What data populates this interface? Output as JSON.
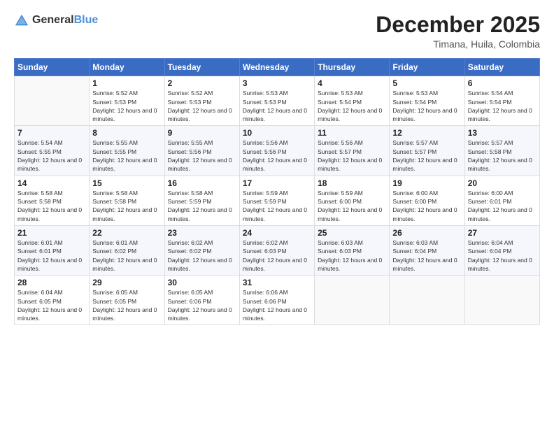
{
  "header": {
    "logo_general": "General",
    "logo_blue": "Blue",
    "title": "December 2025",
    "location": "Timana, Huila, Colombia"
  },
  "weekdays": [
    "Sunday",
    "Monday",
    "Tuesday",
    "Wednesday",
    "Thursday",
    "Friday",
    "Saturday"
  ],
  "weeks": [
    [
      {
        "day": "",
        "sunrise": "",
        "sunset": "",
        "daylight": ""
      },
      {
        "day": "1",
        "sunrise": "5:52 AM",
        "sunset": "5:53 PM",
        "daylight": "12 hours and 0 minutes."
      },
      {
        "day": "2",
        "sunrise": "5:52 AM",
        "sunset": "5:53 PM",
        "daylight": "12 hours and 0 minutes."
      },
      {
        "day": "3",
        "sunrise": "5:53 AM",
        "sunset": "5:53 PM",
        "daylight": "12 hours and 0 minutes."
      },
      {
        "day": "4",
        "sunrise": "5:53 AM",
        "sunset": "5:54 PM",
        "daylight": "12 hours and 0 minutes."
      },
      {
        "day": "5",
        "sunrise": "5:53 AM",
        "sunset": "5:54 PM",
        "daylight": "12 hours and 0 minutes."
      },
      {
        "day": "6",
        "sunrise": "5:54 AM",
        "sunset": "5:54 PM",
        "daylight": "12 hours and 0 minutes."
      }
    ],
    [
      {
        "day": "7",
        "sunrise": "5:54 AM",
        "sunset": "5:55 PM",
        "daylight": "12 hours and 0 minutes."
      },
      {
        "day": "8",
        "sunrise": "5:55 AM",
        "sunset": "5:55 PM",
        "daylight": "12 hours and 0 minutes."
      },
      {
        "day": "9",
        "sunrise": "5:55 AM",
        "sunset": "5:56 PM",
        "daylight": "12 hours and 0 minutes."
      },
      {
        "day": "10",
        "sunrise": "5:56 AM",
        "sunset": "5:56 PM",
        "daylight": "12 hours and 0 minutes."
      },
      {
        "day": "11",
        "sunrise": "5:56 AM",
        "sunset": "5:57 PM",
        "daylight": "12 hours and 0 minutes."
      },
      {
        "day": "12",
        "sunrise": "5:57 AM",
        "sunset": "5:57 PM",
        "daylight": "12 hours and 0 minutes."
      },
      {
        "day": "13",
        "sunrise": "5:57 AM",
        "sunset": "5:58 PM",
        "daylight": "12 hours and 0 minutes."
      }
    ],
    [
      {
        "day": "14",
        "sunrise": "5:58 AM",
        "sunset": "5:58 PM",
        "daylight": "12 hours and 0 minutes."
      },
      {
        "day": "15",
        "sunrise": "5:58 AM",
        "sunset": "5:58 PM",
        "daylight": "12 hours and 0 minutes."
      },
      {
        "day": "16",
        "sunrise": "5:58 AM",
        "sunset": "5:59 PM",
        "daylight": "12 hours and 0 minutes."
      },
      {
        "day": "17",
        "sunrise": "5:59 AM",
        "sunset": "5:59 PM",
        "daylight": "12 hours and 0 minutes."
      },
      {
        "day": "18",
        "sunrise": "5:59 AM",
        "sunset": "6:00 PM",
        "daylight": "12 hours and 0 minutes."
      },
      {
        "day": "19",
        "sunrise": "6:00 AM",
        "sunset": "6:00 PM",
        "daylight": "12 hours and 0 minutes."
      },
      {
        "day": "20",
        "sunrise": "6:00 AM",
        "sunset": "6:01 PM",
        "daylight": "12 hours and 0 minutes."
      }
    ],
    [
      {
        "day": "21",
        "sunrise": "6:01 AM",
        "sunset": "6:01 PM",
        "daylight": "12 hours and 0 minutes."
      },
      {
        "day": "22",
        "sunrise": "6:01 AM",
        "sunset": "6:02 PM",
        "daylight": "12 hours and 0 minutes."
      },
      {
        "day": "23",
        "sunrise": "6:02 AM",
        "sunset": "6:02 PM",
        "daylight": "12 hours and 0 minutes."
      },
      {
        "day": "24",
        "sunrise": "6:02 AM",
        "sunset": "6:03 PM",
        "daylight": "12 hours and 0 minutes."
      },
      {
        "day": "25",
        "sunrise": "6:03 AM",
        "sunset": "6:03 PM",
        "daylight": "12 hours and 0 minutes."
      },
      {
        "day": "26",
        "sunrise": "6:03 AM",
        "sunset": "6:04 PM",
        "daylight": "12 hours and 0 minutes."
      },
      {
        "day": "27",
        "sunrise": "6:04 AM",
        "sunset": "6:04 PM",
        "daylight": "12 hours and 0 minutes."
      }
    ],
    [
      {
        "day": "28",
        "sunrise": "6:04 AM",
        "sunset": "6:05 PM",
        "daylight": "12 hours and 0 minutes."
      },
      {
        "day": "29",
        "sunrise": "6:05 AM",
        "sunset": "6:05 PM",
        "daylight": "12 hours and 0 minutes."
      },
      {
        "day": "30",
        "sunrise": "6:05 AM",
        "sunset": "6:06 PM",
        "daylight": "12 hours and 0 minutes."
      },
      {
        "day": "31",
        "sunrise": "6:06 AM",
        "sunset": "6:06 PM",
        "daylight": "12 hours and 0 minutes."
      },
      {
        "day": "",
        "sunrise": "",
        "sunset": "",
        "daylight": ""
      },
      {
        "day": "",
        "sunrise": "",
        "sunset": "",
        "daylight": ""
      },
      {
        "day": "",
        "sunrise": "",
        "sunset": "",
        "daylight": ""
      }
    ]
  ]
}
